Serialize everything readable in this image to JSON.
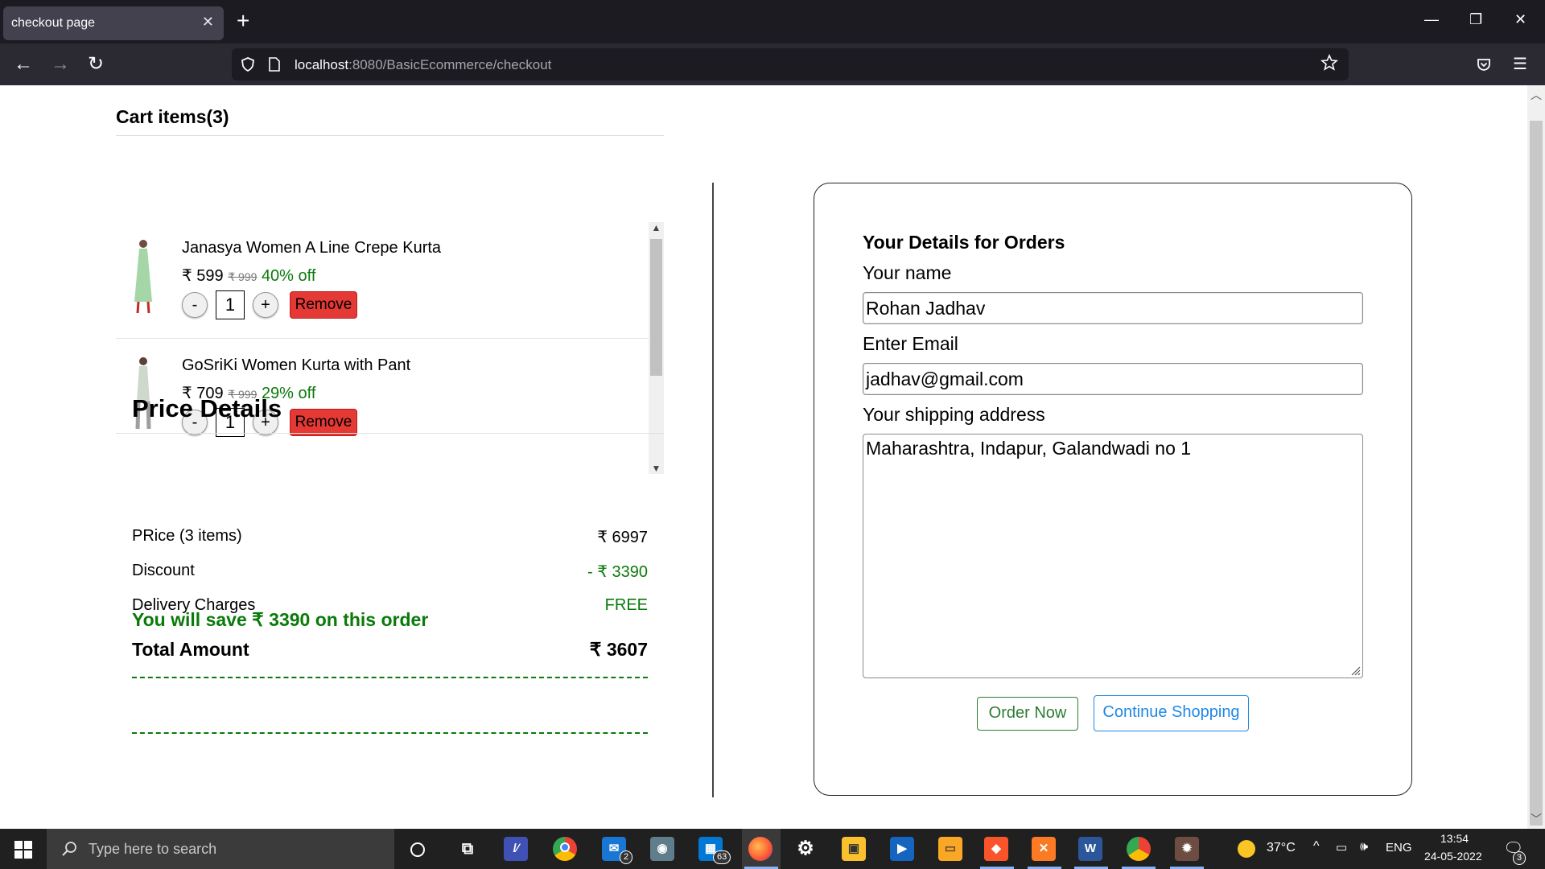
{
  "browser": {
    "tab_title": "checkout page",
    "url_host": "localhost",
    "url_rest": ":8080/BasicEcommerce/checkout"
  },
  "cart": {
    "title": "Cart items(3)",
    "items": [
      {
        "name": "Janasya Women A Line Crepe Kurta",
        "price": "₹ 599",
        "mrp": "₹ 999",
        "discount": "40% off",
        "quantity": "1",
        "minus": "-",
        "plus": "+",
        "remove": "Remove",
        "image_color": "#a5d6a7"
      },
      {
        "name": "GoSriKi Women Kurta with Pant",
        "price": "₹ 709",
        "mrp": "₹ 999",
        "discount": "29% off",
        "quantity": "1",
        "minus": "-",
        "plus": "+",
        "remove": "Remove",
        "image_color": "#cfd8cc"
      }
    ]
  },
  "price_details": {
    "title": "Price Details",
    "price_label": "PRice (3 items)",
    "price_value": "₹ 6997",
    "discount_label": "Discount",
    "discount_value": "- ₹ 3390",
    "delivery_label": "Delivery Charges",
    "delivery_value": "FREE",
    "total_label": "Total Amount",
    "total_value": "₹ 3607",
    "savings_text": "You will save ₹ 3390 on this order"
  },
  "order_form": {
    "title": "Your Details for Orders",
    "name_label": "Your name",
    "name_value": "Rohan Jadhav",
    "email_label": "Enter Email",
    "email_value": "jadhav@gmail.com",
    "address_label": "Your shipping address",
    "address_value": "Maharashtra, Indapur, Galandwadi no 1",
    "order_button": "Order Now",
    "continue_button": "Continue Shopping"
  },
  "taskbar": {
    "search_placeholder": "Type here to search",
    "mail_badge": "2",
    "store_badge": "63",
    "temperature": "37°C",
    "language": "ENG",
    "time": "13:54",
    "date": "24-05-2022",
    "notification_count": "3"
  },
  "colors": {
    "accent_green": "#0a7a0a",
    "remove_red": "#e53935",
    "continue_blue": "#1e88e5"
  }
}
